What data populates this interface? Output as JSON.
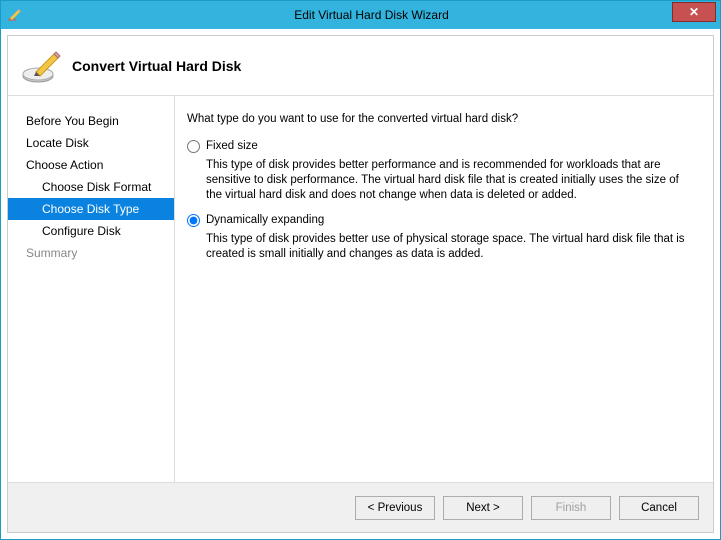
{
  "titlebar": {
    "title": "Edit Virtual Hard Disk Wizard"
  },
  "header": {
    "title": "Convert Virtual Hard Disk"
  },
  "sidebar": {
    "items": [
      {
        "label": "Before You Begin",
        "sub": false,
        "selected": false,
        "disabled": false
      },
      {
        "label": "Locate Disk",
        "sub": false,
        "selected": false,
        "disabled": false
      },
      {
        "label": "Choose Action",
        "sub": false,
        "selected": false,
        "disabled": false
      },
      {
        "label": "Choose Disk Format",
        "sub": true,
        "selected": false,
        "disabled": false
      },
      {
        "label": "Choose Disk Type",
        "sub": true,
        "selected": true,
        "disabled": false
      },
      {
        "label": "Configure Disk",
        "sub": true,
        "selected": false,
        "disabled": false
      },
      {
        "label": "Summary",
        "sub": false,
        "selected": false,
        "disabled": true
      }
    ]
  },
  "main": {
    "question": "What type do you want to use for the converted virtual hard disk?",
    "options": [
      {
        "label": "Fixed size",
        "checked": false,
        "desc": "This type of disk provides better performance and is recommended for workloads that are sensitive to disk performance. The virtual hard disk file that is created initially uses the size of the virtual hard disk and does not change when data is deleted or added."
      },
      {
        "label": "Dynamically expanding",
        "checked": true,
        "desc": "This type of disk provides better use of physical storage space. The virtual hard disk file that is created is small initially and changes as data is added."
      }
    ]
  },
  "footer": {
    "previous": "< Previous",
    "next": "Next >",
    "finish": "Finish",
    "cancel": "Cancel"
  }
}
